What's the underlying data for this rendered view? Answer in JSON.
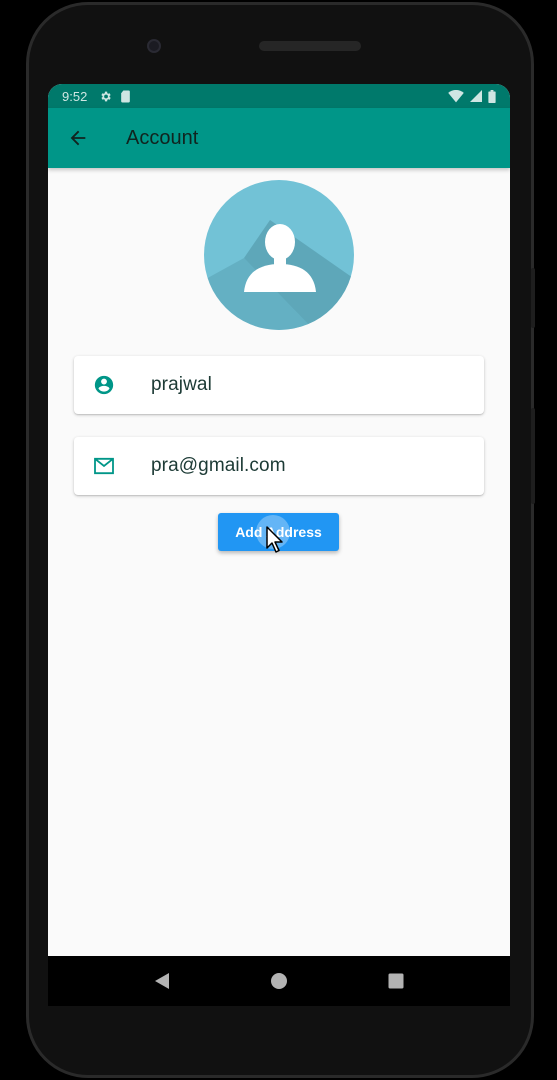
{
  "status_bar": {
    "time": "9:52",
    "left_icons": [
      "settings-icon",
      "sim-card-icon"
    ],
    "right_icons": [
      "wifi-icon",
      "signal-icon",
      "battery-icon"
    ],
    "color": "#00796b"
  },
  "app_bar": {
    "title": "Account",
    "back_icon": "arrow-back-icon",
    "color": "#009688"
  },
  "profile": {
    "avatar_icon": "person-silhouette-icon",
    "name": "prajwal",
    "name_icon": "account-circle-icon",
    "email": "pra@gmail.com",
    "email_icon": "mail-icon"
  },
  "actions": {
    "add_address_label": "Add Address",
    "button_color": "#2196f3"
  },
  "nav_bar": {
    "items": [
      "back-triangle-icon",
      "home-circle-icon",
      "recents-square-icon"
    ]
  }
}
